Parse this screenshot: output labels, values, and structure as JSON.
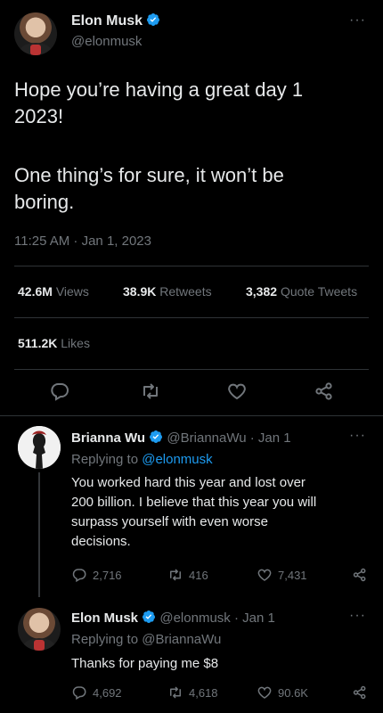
{
  "tweet": {
    "author_name": "Elon Musk",
    "handle": "@elonmusk",
    "text_line1": "Hope you’re having a great day 1",
    "text_line2": "2023!",
    "text_line3": "One thing’s for sure, it won’t be",
    "text_line4": "boring.",
    "timestamp": "11:25 AM · Jan 1, 2023",
    "views_count": "42.6M",
    "views_label": "Views",
    "retweets_count": "38.9K",
    "retweets_label": "Retweets",
    "quotes_count": "3,382",
    "quotes_label": "Quote Tweets",
    "likes_count": "511.2K",
    "likes_label": "Likes",
    "more_glyph": "···"
  },
  "replies": [
    {
      "name": "Brianna Wu",
      "meta": "@BriannaWu · Jan 1",
      "replying_prefix": "Replying to",
      "replying_to": "@elonmusk",
      "text_line1": "You worked hard this year and lost over",
      "text_line2": "200 billion. I believe that this year you will",
      "text_line3": "surpass yourself with even worse",
      "text_line4": "decisions.",
      "replies_count": "2,716",
      "retweets_count": "416",
      "likes_count": "7,431"
    },
    {
      "name": "Elon Musk",
      "meta": "@elonmusk · Jan 1",
      "replying_prefix": "Replying to",
      "replying_to": "@BriannaWu",
      "text_line1": "Thanks for paying me $8",
      "replies_count": "4,692",
      "retweets_count": "4,618",
      "likes_count": "90.6K"
    }
  ],
  "colors": {
    "background": "#000000",
    "text": "#e7e9ea",
    "muted": "#71767b",
    "accent": "#1d9bf0",
    "divider": "#2f3336"
  }
}
